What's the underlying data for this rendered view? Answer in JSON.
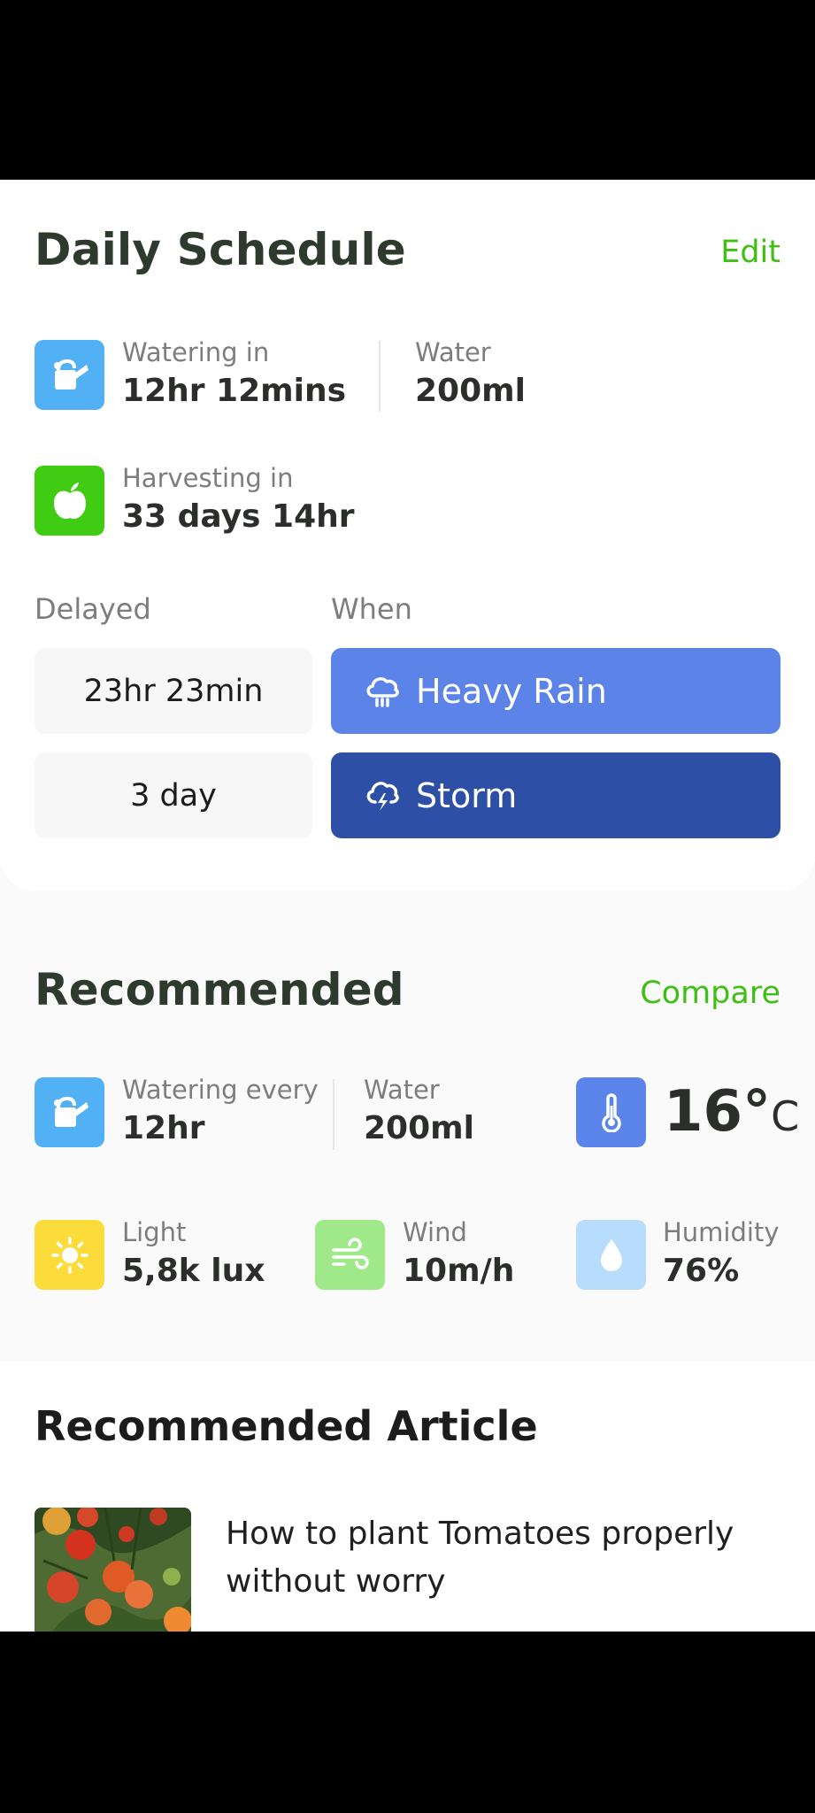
{
  "daily_schedule": {
    "title": "Daily Schedule",
    "edit_label": "Edit",
    "watering": {
      "label": "Watering in",
      "value": "12hr 12mins",
      "icon": "watering-can-icon"
    },
    "water": {
      "label": "Water",
      "value": "200ml"
    },
    "harvesting": {
      "label": "Harvesting in",
      "value": "33 days 14hr",
      "icon": "apple-icon"
    },
    "delayed_header": "Delayed",
    "when_header": "When",
    "delays": [
      {
        "delay": "23hr 23min",
        "condition": "Heavy Rain",
        "icon": "cloud-rain-icon",
        "color": "#5b83e8"
      },
      {
        "delay": "3 day",
        "condition": "Storm",
        "icon": "cloud-lightning-icon",
        "color": "#2d4fa6"
      }
    ]
  },
  "recommended": {
    "title": "Recommended",
    "compare_label": "Compare",
    "watering": {
      "label": "Watering every",
      "value": "12hr",
      "icon": "watering-can-icon"
    },
    "water": {
      "label": "Water",
      "value": "200ml"
    },
    "temperature": {
      "value": "16°",
      "unit": "C",
      "icon": "thermometer-icon"
    },
    "light": {
      "label": "Light",
      "value": "5,8k lux",
      "icon": "sun-icon"
    },
    "wind": {
      "label": "Wind",
      "value": "10m/h",
      "icon": "wind-icon"
    },
    "humidity": {
      "label": "Humidity",
      "value": "76%",
      "icon": "droplet-icon"
    }
  },
  "article": {
    "section_title": "Recommended Article",
    "title": "How to plant Tomatoes properly without worry"
  },
  "colors": {
    "accent_green": "#3fbf14",
    "water_blue": "#52b1f5",
    "harvest_green": "#3fcc12",
    "rain_blue": "#5b83e8",
    "storm_blue": "#2d4fa6",
    "temp_blue": "#5b85ea",
    "light_yellow": "#fbdc3a",
    "wind_green": "#a0e98a",
    "humidity_blue": "#b8dcfb"
  }
}
